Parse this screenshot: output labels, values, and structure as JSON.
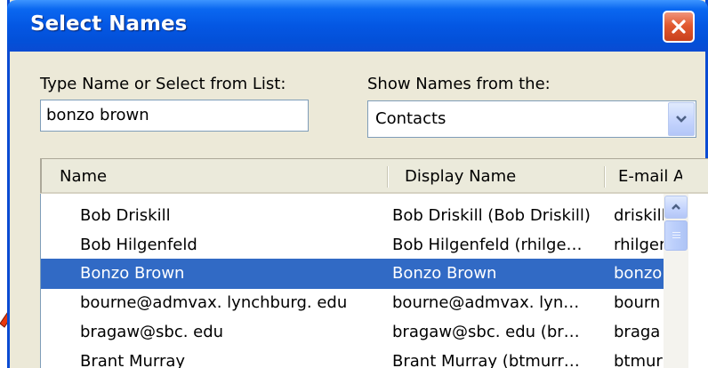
{
  "window": {
    "title": "Select Names"
  },
  "search": {
    "label": "Type Name or Select from List:",
    "value": "bonzo brown"
  },
  "address_book": {
    "label": "Show Names from the:",
    "selected": "Contacts"
  },
  "list": {
    "columns": [
      "Name",
      "Display Name",
      "E-mail A"
    ],
    "rows": [
      {
        "name": "Bob Driskill",
        "display": "Bob Driskill (Bob Driskill)",
        "email": "driskill",
        "selected": false
      },
      {
        "name": "Bob Hilgenfeld",
        "display": "Bob Hilgenfeld (rhilge…",
        "email": "rhilger",
        "selected": false
      },
      {
        "name": "Bonzo Brown",
        "display": "Bonzo Brown",
        "email": "bonzo",
        "selected": true
      },
      {
        "name": "bourne@admvax. lynchburg. edu",
        "display": "bourne@admvax. lyn…",
        "email": "bourn",
        "selected": false
      },
      {
        "name": "bragaw@sbc. edu",
        "display": "bragaw@sbc. edu (br…",
        "email": "braga",
        "selected": false
      },
      {
        "name": "Brant Murray",
        "display": "Brant Murray (btmurr…",
        "email": "btmur",
        "selected": false
      }
    ]
  },
  "colors": {
    "titlebar": "#0457e3",
    "selection": "#316ac5",
    "close": "#e2592f",
    "pointer": "#e8380d"
  },
  "icons": {
    "close": "close-icon",
    "dropdown": "chevron-down-icon",
    "scroll_up": "chevron-up-icon",
    "pointer": "arrow-pointer-icon"
  }
}
